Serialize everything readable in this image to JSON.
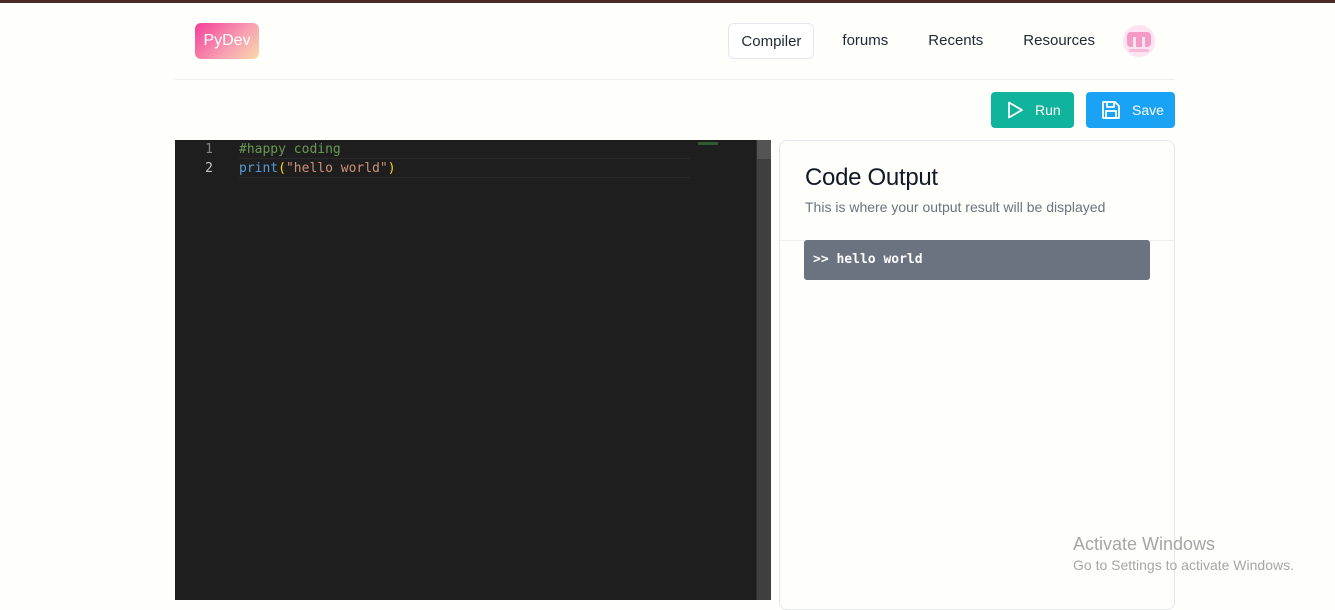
{
  "nav": {
    "logo": "PyDev",
    "links": [
      "Compiler",
      "forums",
      "Recents",
      "Resources"
    ],
    "active": "Compiler"
  },
  "toolbar": {
    "run_label": "Run",
    "save_label": "Save"
  },
  "editor": {
    "lines": [
      {
        "num": "1",
        "comment": "#happy coding"
      },
      {
        "num": "2",
        "fn": "print",
        "open": "(",
        "str": "\"hello world\"",
        "close": ")"
      }
    ]
  },
  "output_panel": {
    "title": "Code Output",
    "subtitle": "This is where your output result will be displayed",
    "result": ">> hello world"
  },
  "watermark": {
    "title": "Activate Windows",
    "subtitle": "Go to Settings to activate Windows."
  },
  "colors": {
    "run": "#10b39c",
    "save": "#1aa3f5",
    "editor_bg": "#1e1e1e",
    "output_bg": "#6b7280"
  }
}
